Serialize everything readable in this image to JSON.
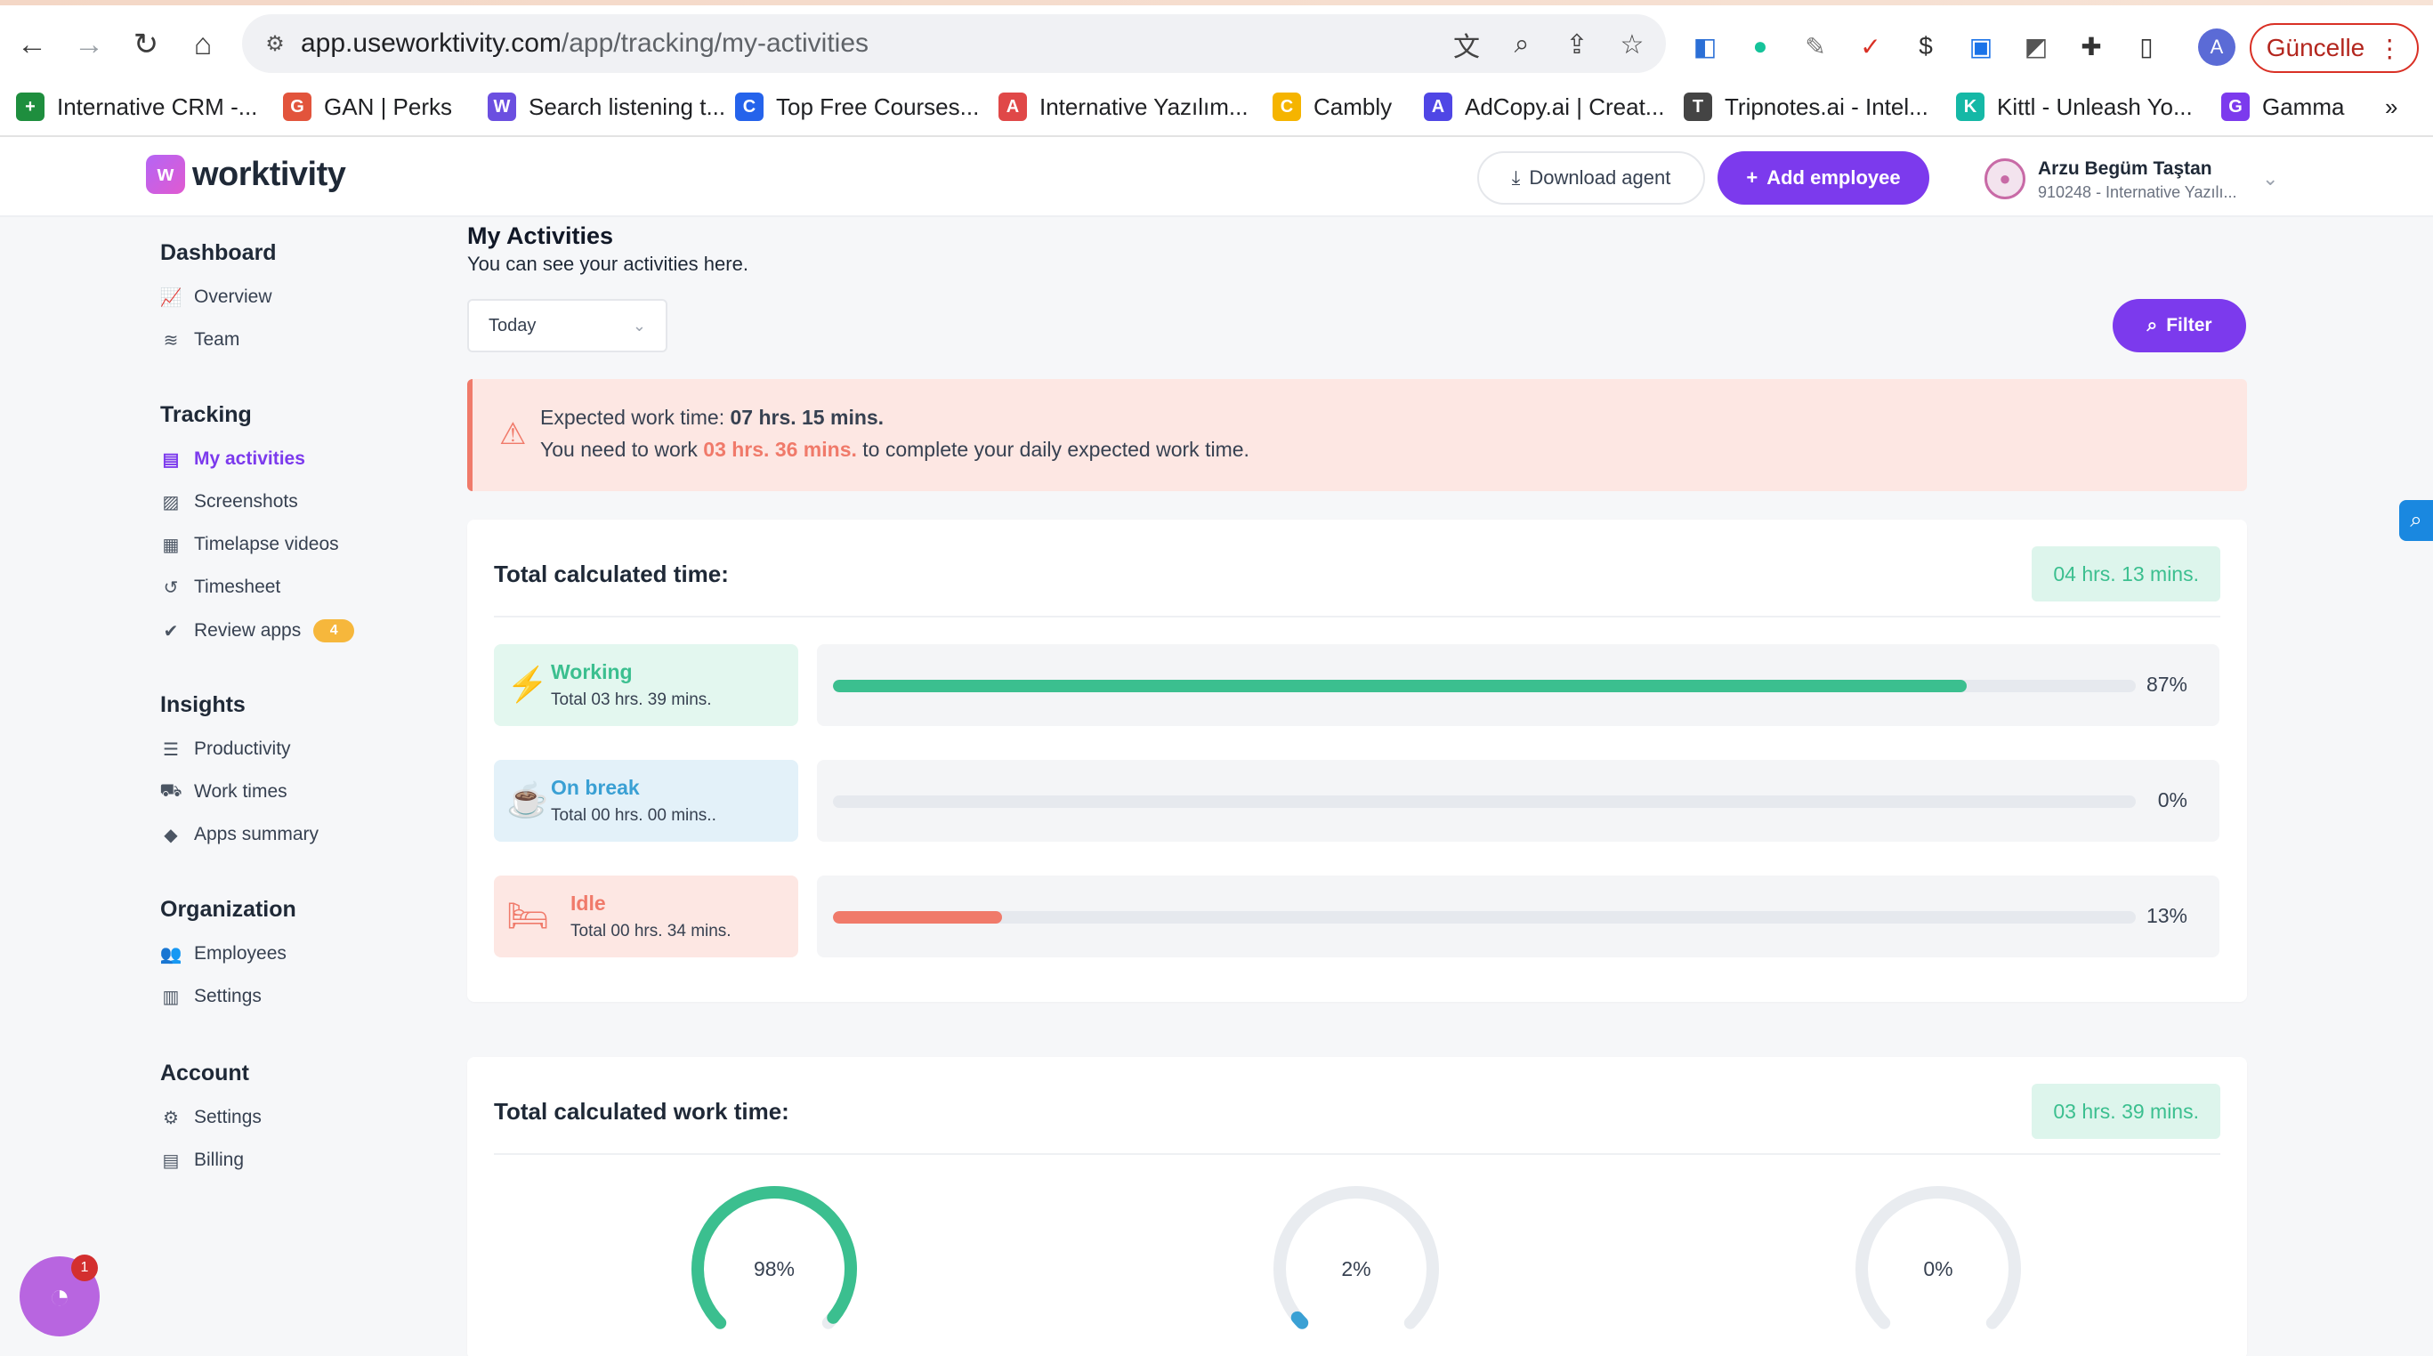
{
  "browser": {
    "url_host": "app.useworktivity.com",
    "url_path": "/app/tracking/my-activities",
    "update_button": "Güncelle",
    "profile_initial": "A",
    "bookmarks": [
      {
        "label": "Internative CRM -...",
        "color": "#1e8e3e",
        "glyph": "+"
      },
      {
        "label": "GAN | Perks",
        "color": "#e2543c",
        "glyph": "G"
      },
      {
        "label": "Search listening t...",
        "color": "#6b4fe0",
        "glyph": "W"
      },
      {
        "label": "Top Free Courses...",
        "color": "#2563eb",
        "glyph": "C"
      },
      {
        "label": "Internative Yazılım...",
        "color": "#e04848",
        "glyph": "A"
      },
      {
        "label": "Cambly",
        "color": "#f5b400",
        "glyph": "C"
      },
      {
        "label": "AdCopy.ai | Creat...",
        "color": "#4f46e5",
        "glyph": "A"
      },
      {
        "label": "Tripnotes.ai - Intel...",
        "color": "#444444",
        "glyph": "T"
      },
      {
        "label": "Kittl - Unleash Yo...",
        "color": "#15b8a6",
        "glyph": "K"
      },
      {
        "label": "Gamma",
        "color": "#7c3aed",
        "glyph": "G"
      }
    ],
    "more_bookmarks": "»"
  },
  "header": {
    "logo_text": "worktivity",
    "download_label": "Download agent",
    "add_employee_label": "Add employee",
    "user_name": "Arzu Begüm Taştan",
    "user_sub": "910248 - Internative Yazılı..."
  },
  "sidebar": {
    "sections": [
      {
        "title": "Dashboard",
        "items": [
          {
            "label": "Overview",
            "icon": "chart-icon"
          },
          {
            "label": "Team",
            "icon": "layers-icon"
          }
        ]
      },
      {
        "title": "Tracking",
        "items": [
          {
            "label": "My activities",
            "icon": "activity-icon",
            "active": true
          },
          {
            "label": "Screenshots",
            "icon": "image-icon"
          },
          {
            "label": "Timelapse videos",
            "icon": "video-icon"
          },
          {
            "label": "Timesheet",
            "icon": "history-icon"
          },
          {
            "label": "Review apps",
            "icon": "check-circle-icon",
            "badge": "4"
          }
        ]
      },
      {
        "title": "Insights",
        "items": [
          {
            "label": "Productivity",
            "icon": "list-icon"
          },
          {
            "label": "Work times",
            "icon": "truck-icon"
          },
          {
            "label": "Apps summary",
            "icon": "shapes-icon"
          }
        ]
      },
      {
        "title": "Organization",
        "items": [
          {
            "label": "Employees",
            "icon": "users-icon"
          },
          {
            "label": "Settings",
            "icon": "building-icon"
          }
        ]
      },
      {
        "title": "Account",
        "items": [
          {
            "label": "Settings",
            "icon": "user-gear-icon"
          },
          {
            "label": "Billing",
            "icon": "file-icon"
          }
        ]
      }
    ]
  },
  "page": {
    "title": "My Activities",
    "subtitle": "You can see your activities here.",
    "date_filter": "Today",
    "filter_label": "Filter"
  },
  "alert": {
    "expected_prefix": "Expected work time: ",
    "expected_value": "07 hrs. 15 mins.",
    "need_prefix": "You need to work ",
    "need_value": "03 hrs. 36 mins.",
    "need_suffix": " to complete your daily expected work time."
  },
  "total_time": {
    "title": "Total calculated time:",
    "value": "04 hrs. 13 mins.",
    "rows": [
      {
        "label": "Working",
        "total": "Total 03 hrs. 39 mins.",
        "percent": 87,
        "percent_text": "87%",
        "color": "#3bbf8f",
        "bg": "#e3f7ef"
      },
      {
        "label": "On break",
        "total": "Total 00 hrs. 00 mins..",
        "percent": 0,
        "percent_text": "0%",
        "color": "#3aa0d4",
        "bg": "#e3f1f9"
      },
      {
        "label": "Idle",
        "total": "Total 00 hrs. 34 mins.",
        "percent": 13,
        "percent_text": "13%",
        "color": "#f07a6a",
        "bg": "#fde7e3"
      }
    ]
  },
  "work_time": {
    "title": "Total calculated work time:",
    "value": "03 hrs. 39 mins.",
    "gauges": [
      {
        "percent": 98,
        "text": "98%",
        "color": "#3bbf8f"
      },
      {
        "percent": 2,
        "text": "2%",
        "color": "#3aa0d4"
      },
      {
        "percent": 0,
        "text": "0%",
        "color": "#9ca3af"
      }
    ]
  },
  "chat": {
    "count": "1"
  }
}
